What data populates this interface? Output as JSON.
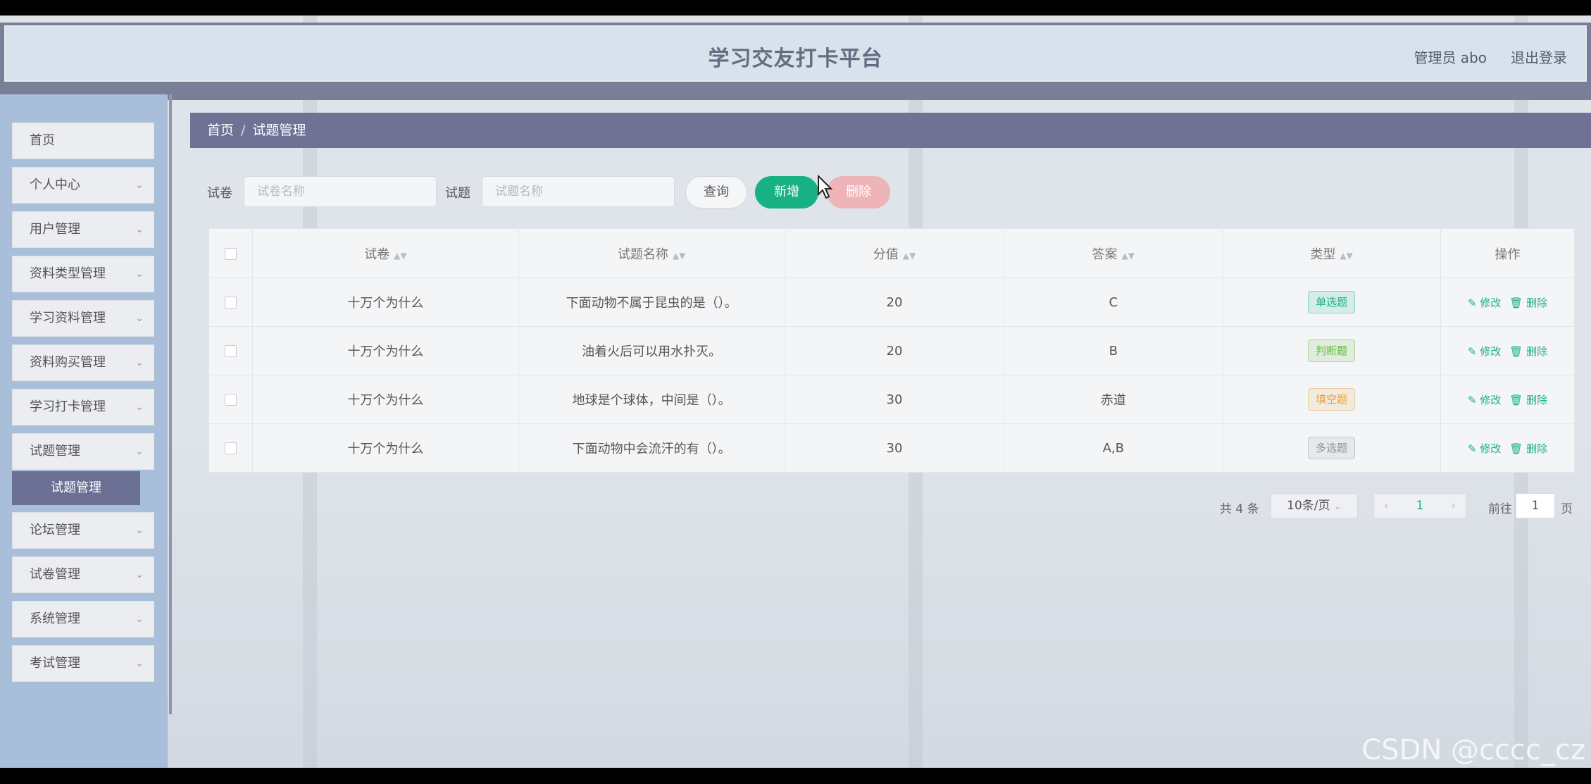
{
  "header": {
    "title": "学习交友打卡平台",
    "admin_label": "管理员 abo",
    "logout_label": "退出登录"
  },
  "sidebar": {
    "items": [
      {
        "label": "首页",
        "expandable": false
      },
      {
        "label": "个人中心",
        "expandable": true
      },
      {
        "label": "用户管理",
        "expandable": true
      },
      {
        "label": "资料类型管理",
        "expandable": true
      },
      {
        "label": "学习资料管理",
        "expandable": true
      },
      {
        "label": "资料购买管理",
        "expandable": true
      },
      {
        "label": "学习打卡管理",
        "expandable": true
      },
      {
        "label": "试题管理",
        "expandable": true
      },
      {
        "label": "论坛管理",
        "expandable": true
      },
      {
        "label": "试卷管理",
        "expandable": true
      },
      {
        "label": "系统管理",
        "expandable": true
      },
      {
        "label": "考试管理",
        "expandable": true
      }
    ],
    "active_sub": "试题管理",
    "chevron": "chevron-down-icon"
  },
  "breadcrumb": {
    "home": "首页",
    "separator": "/",
    "current": "试题管理"
  },
  "search": {
    "paper_label": "试卷",
    "paper_placeholder": "试卷名称",
    "question_label": "试题",
    "question_placeholder": "试题名称",
    "query_label": "查询",
    "add_label": "新增",
    "delete_label": "删除"
  },
  "table": {
    "headers": [
      "试卷",
      "试题名称",
      "分值",
      "答案",
      "类型",
      "操作"
    ],
    "rows": [
      {
        "paper": "十万个为什么",
        "question": "下面动物不属于昆虫的是（）。",
        "score": "20",
        "answer": "C",
        "type": "单选题",
        "type_color": "#18b184"
      },
      {
        "paper": "十万个为什么",
        "question": "油着火后可以用水扑灭。",
        "score": "20",
        "answer": "B",
        "type": "判断题",
        "type_color": "#5fb83a"
      },
      {
        "paper": "十万个为什么",
        "question": "地球是个球体，中间是（）。",
        "score": "30",
        "answer": "赤道",
        "type": "填空题",
        "type_color": "#e6a23c"
      },
      {
        "paper": "十万个为什么",
        "question": "下面动物中会流汗的有（）。",
        "score": "30",
        "answer": "A,B",
        "type": "多选题",
        "type_color": "#909399"
      }
    ],
    "edit_label": "修改",
    "delete_label": "删除"
  },
  "pagination": {
    "total": "共 4 条",
    "page_size": "10条/页",
    "current_page": "1",
    "goto_label": "前往",
    "goto_value": "1",
    "page_suffix": "页"
  },
  "watermark": "CSDN @cccc_cz",
  "colors": {
    "accent": "#18b184",
    "header_band": "#7a7f98",
    "breadcrumb_bg": "#6f7294",
    "danger_light": "#eeb4b8"
  }
}
